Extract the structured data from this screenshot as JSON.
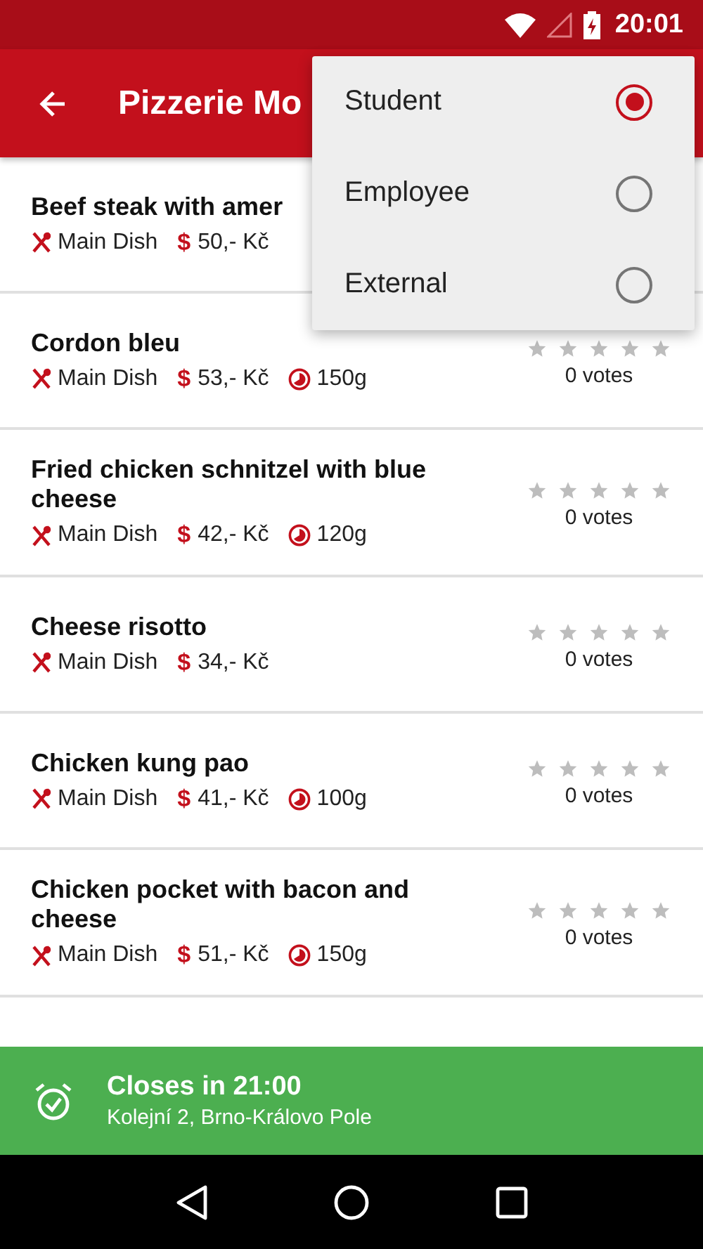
{
  "status_bar": {
    "time": "20:01"
  },
  "app_bar": {
    "title": "Pizzerie Mo"
  },
  "dishes": [
    {
      "name": "Beef steak with amer",
      "category": "Main Dish",
      "price_icon": "$",
      "price": "50,- Kč"
    },
    {
      "name": "Cordon bleu",
      "category": "Main Dish",
      "price_icon": "$",
      "price": "53,- Kč",
      "weight": "150g",
      "stars": 0,
      "votes": "0 votes"
    },
    {
      "name": "Fried chicken schnitzel with blue cheese",
      "category": "Main Dish",
      "price_icon": "$",
      "price": "42,- Kč",
      "weight": "120g",
      "stars": 0,
      "votes": "0 votes"
    },
    {
      "name": "Cheese risotto",
      "category": "Main Dish",
      "price_icon": "$",
      "price": "34,- Kč",
      "stars": 0,
      "votes": "0 votes"
    },
    {
      "name": "Chicken kung pao",
      "category": "Main Dish",
      "price_icon": "$",
      "price": "41,- Kč",
      "weight": "100g",
      "stars": 0,
      "votes": "0 votes"
    },
    {
      "name": "Chicken pocket with bacon and cheese",
      "category": "Main Dish",
      "price_icon": "$",
      "price": "51,- Kč",
      "weight": "150g",
      "stars": 0,
      "votes": "0 votes"
    }
  ],
  "menu": [
    {
      "label": "Student",
      "selected": true
    },
    {
      "label": "Employee",
      "selected": false
    },
    {
      "label": "External",
      "selected": false
    }
  ],
  "banner": {
    "title": "Closes in 21:00",
    "address": "Kolejní 2, Brno-Královo Pole"
  }
}
